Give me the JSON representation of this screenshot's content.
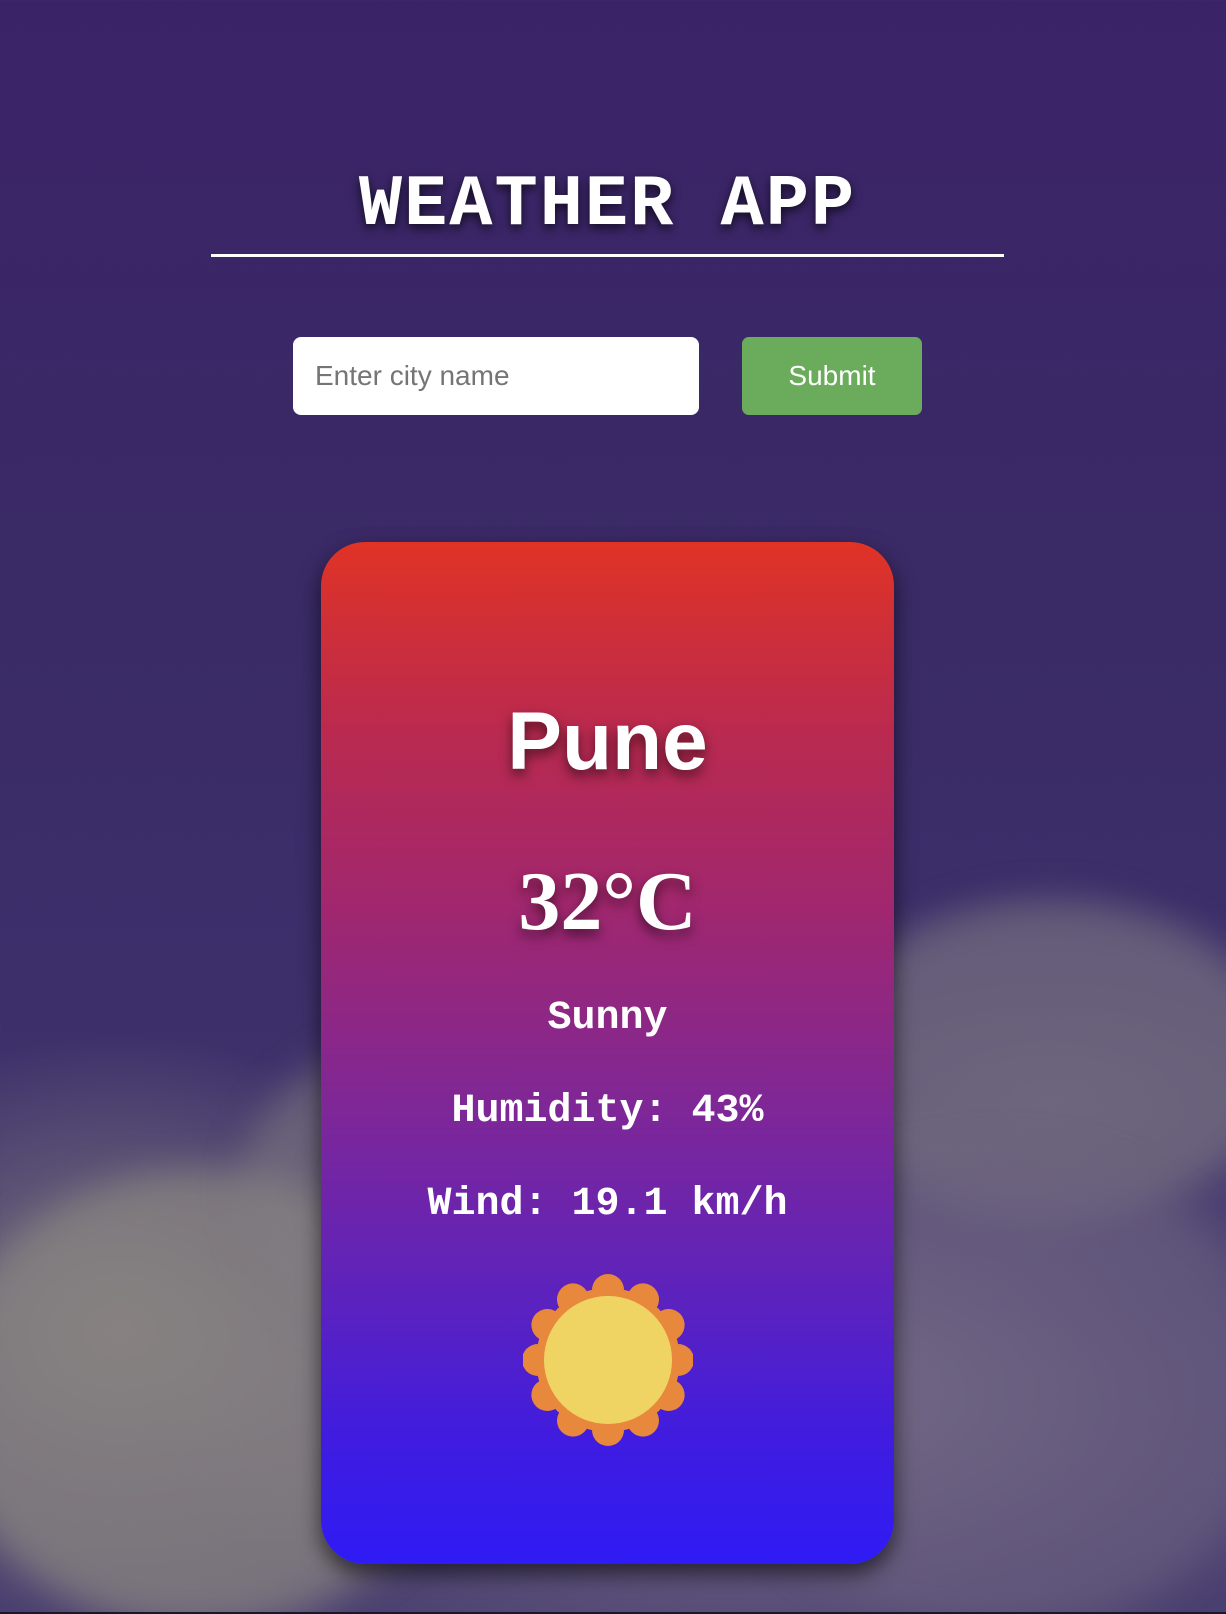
{
  "header": {
    "title": "WEATHER APP"
  },
  "search": {
    "placeholder": "Enter city name",
    "value": "",
    "submit_label": "Submit"
  },
  "weather": {
    "city": "Pune",
    "temperature": "32°C",
    "condition": "Sunny",
    "humidity": "Humidity: 43%",
    "wind": "Wind: 19.1 km/h",
    "icon": "sun-icon"
  },
  "colors": {
    "submit_button": "#6aab5c",
    "card_gradient_top": "#e03325",
    "card_gradient_bottom": "#2f1bf5",
    "sun_outer": "#e8883c",
    "sun_inner": "#f0d463"
  }
}
